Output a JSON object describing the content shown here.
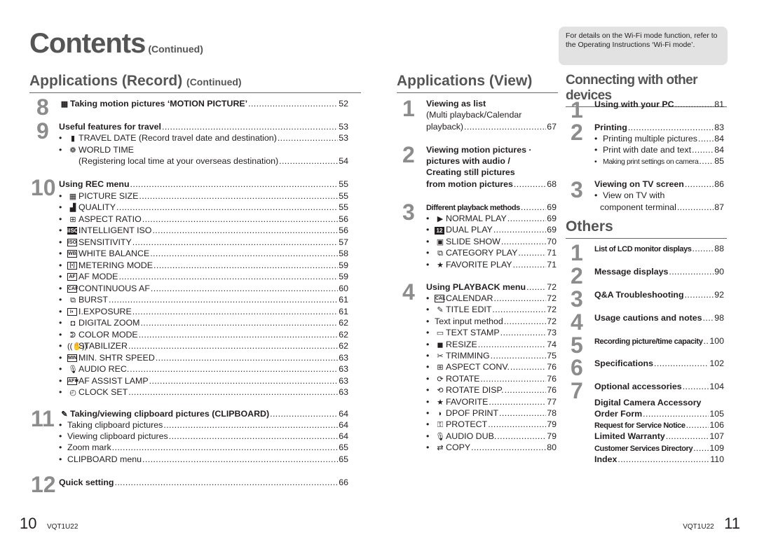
{
  "title": {
    "main": "Contents",
    "sub": "(Continued)"
  },
  "wifi_note": "For details on the Wi-Fi mode function, refer to the Operating Instructions ‘Wi-Fi mode’.",
  "record": {
    "heading": "Applications (Record)",
    "heading_sub": "(Continued)",
    "sections": [
      {
        "num": "8",
        "items": [
          {
            "icon": "motion-picture-icon",
            "glyph": "▦",
            "text": "Taking motion pictures ‘MOTION PICTURE’",
            "page": "52"
          }
        ]
      },
      {
        "num": "9",
        "items": [
          {
            "text": "Useful features for travel",
            "page": "53"
          },
          {
            "icon": "suitcase-icon",
            "glyph": "▮",
            "text": "TRAVEL DATE (Record travel date and destination)",
            "page": "53"
          },
          {
            "icon": "world-icon",
            "glyph": "❁",
            "text": "WORLD TIME",
            "page": ""
          },
          {
            "text": "(Registering local time at your overseas destination)",
            "page": "54"
          }
        ]
      },
      {
        "num": "10",
        "items": [
          {
            "text": "Using REC menu",
            "page": "55"
          },
          {
            "icon": "picture-size-icon",
            "glyph": "▦",
            "text": "PICTURE SIZE",
            "page": "55"
          },
          {
            "icon": "quality-icon",
            "glyph": "▟",
            "text": "QUALITY",
            "page": "55"
          },
          {
            "icon": "aspect-ratio-icon",
            "glyph": "⊞",
            "text": "ASPECT RATIO",
            "page": "56"
          },
          {
            "icon": "intelligent-iso-icon",
            "glyph": "iISO",
            "text": "INTELLIGENT ISO",
            "page": "56"
          },
          {
            "icon": "iso-icon",
            "glyph": "ISO",
            "text": "SENSITIVITY",
            "page": "57"
          },
          {
            "icon": "white-balance-icon",
            "glyph": "WB",
            "text": "WHITE BALANCE",
            "page": "58"
          },
          {
            "icon": "metering-icon",
            "glyph": "[•]",
            "text": "METERING MODE",
            "page": "59"
          },
          {
            "icon": "af-mode-icon",
            "glyph": "AF",
            "text": "AF MODE",
            "page": "59"
          },
          {
            "icon": "continuous-af-icon",
            "glyph": "CAF",
            "text": "CONTINUOUS AF",
            "page": "60"
          },
          {
            "icon": "burst-icon",
            "glyph": "⧉",
            "text": "BURST",
            "page": "61"
          },
          {
            "icon": "i-exposure-icon",
            "glyph": "i◐",
            "text": "I.EXPOSURE",
            "page": "61"
          },
          {
            "icon": "digital-zoom-icon",
            "glyph": "◘",
            "text": "DIGITAL ZOOM",
            "page": "62"
          },
          {
            "icon": "color-mode-icon",
            "glyph": "ᕲ",
            "text": "COLOR MODE",
            "page": "62"
          },
          {
            "icon": "stabilizer-icon",
            "glyph": "((✋))",
            "text": "STABILIZER",
            "page": "62"
          },
          {
            "icon": "min-shutter-icon",
            "glyph": "MIN",
            "text": "MIN. SHTR SPEED",
            "page": "63"
          },
          {
            "icon": "microphone-icon",
            "glyph": "🎙",
            "text": "AUDIO REC.",
            "page": "63"
          },
          {
            "icon": "af-assist-icon",
            "glyph": "AF✱",
            "text": "AF ASSIST LAMP",
            "page": "63"
          },
          {
            "icon": "clock-icon",
            "glyph": "◴",
            "text": "CLOCK SET",
            "page": "63"
          }
        ]
      },
      {
        "num": "11",
        "items": [
          {
            "icon": "clipboard-icon",
            "glyph": "✎",
            "text": "Taking/viewing clipboard pictures (CLIPBOARD)",
            "page": "64"
          },
          {
            "text": "Taking clipboard pictures",
            "page": "64"
          },
          {
            "text": "Viewing clipboard pictures",
            "page": "64"
          },
          {
            "text": "Zoom mark",
            "page": "65"
          },
          {
            "text": "CLIPBOARD menu",
            "page": "65"
          }
        ]
      },
      {
        "num": "12",
        "items": [
          {
            "text": "Quick setting",
            "page": "66"
          }
        ]
      }
    ]
  },
  "view": {
    "heading": "Applications (View)",
    "sections": [
      {
        "num": "1",
        "items": [
          {
            "text": "Viewing as list",
            "page": ""
          },
          {
            "text": "(Multi playback/Calendar",
            "page": ""
          },
          {
            "text": "playback)",
            "page": "67"
          }
        ]
      },
      {
        "num": "2",
        "items": [
          {
            "text": "Viewing motion pictures ·",
            "page": ""
          },
          {
            "text": "pictures with audio /",
            "page": ""
          },
          {
            "text": "Creating still pictures",
            "page": ""
          },
          {
            "text": "from motion pictures",
            "page": "68"
          }
        ]
      },
      {
        "num": "3",
        "items": [
          {
            "text": "Different playback methods",
            "page": "69"
          },
          {
            "icon": "play-icon",
            "glyph": "▶",
            "text": "NORMAL PLAY",
            "page": "69"
          },
          {
            "icon": "dual-play-icon",
            "glyph": "12",
            "text": "DUAL PLAY",
            "page": "69"
          },
          {
            "icon": "slide-show-icon",
            "glyph": "▣",
            "text": "SLIDE SHOW",
            "page": "70"
          },
          {
            "icon": "category-play-icon",
            "glyph": "⧉",
            "text": "CATEGORY PLAY",
            "page": "71"
          },
          {
            "icon": "star-icon",
            "glyph": "★",
            "text": "FAVORITE PLAY",
            "page": "71"
          }
        ]
      },
      {
        "num": "4",
        "items": [
          {
            "text": "Using PLAYBACK menu",
            "page": "72"
          },
          {
            "icon": "calendar-icon",
            "glyph": "CAL",
            "text": "CALENDAR",
            "page": "72"
          },
          {
            "icon": "title-edit-icon",
            "glyph": "✎",
            "text": "TITLE EDIT",
            "page": "72"
          },
          {
            "text": "Text input method",
            "page": "72"
          },
          {
            "icon": "text-stamp-icon",
            "glyph": "▭",
            "text": "TEXT STAMP",
            "page": "73"
          },
          {
            "icon": "resize-icon",
            "glyph": "◼",
            "text": "RESIZE",
            "page": "74"
          },
          {
            "icon": "scissors-icon",
            "glyph": "✂",
            "text": "TRIMMING",
            "page": "75"
          },
          {
            "icon": "aspect-conv-icon",
            "glyph": "⊞",
            "text": "ASPECT CONV.",
            "page": "76"
          },
          {
            "icon": "rotate-icon",
            "glyph": "⟳",
            "text": "ROTATE",
            "page": "76"
          },
          {
            "icon": "rotate-disp-icon",
            "glyph": "⟲",
            "text": "ROTATE DISP.",
            "page": "76"
          },
          {
            "icon": "star-icon",
            "glyph": "★",
            "text": "FAVORITE",
            "page": "77"
          },
          {
            "icon": "dpof-icon",
            "glyph": "◗",
            "text": "DPOF PRINT",
            "page": "78"
          },
          {
            "icon": "key-icon",
            "glyph": "⚿",
            "text": "PROTECT",
            "page": "79"
          },
          {
            "icon": "microphone-icon",
            "glyph": "🎙",
            "text": "AUDIO DUB.",
            "page": "79"
          },
          {
            "icon": "copy-icon",
            "glyph": "⇄",
            "text": "COPY",
            "page": "80"
          }
        ]
      }
    ]
  },
  "connect": {
    "heading": "Connecting with other devices",
    "sections": [
      {
        "num": "1",
        "items": [
          {
            "text": "Using with your PC",
            "page": "81"
          }
        ]
      },
      {
        "num": "2",
        "items": [
          {
            "text": "Printing",
            "page": "83"
          },
          {
            "text": "Printing multiple pictures",
            "page": "84"
          },
          {
            "text": "Print with date and text",
            "page": "84"
          },
          {
            "text": "Making print settings on camera",
            "page": "85"
          }
        ]
      },
      {
        "num": "3",
        "items": [
          {
            "text": "Viewing on TV screen",
            "page": "86"
          },
          {
            "text": "View on TV with",
            "page": ""
          },
          {
            "text": "component terminal",
            "page": "87"
          }
        ]
      }
    ]
  },
  "others": {
    "heading": "Others",
    "sections": [
      {
        "num": "1",
        "items": [
          {
            "text": "List of LCD monitor displays",
            "page": "88"
          }
        ]
      },
      {
        "num": "2",
        "items": [
          {
            "text": "Message displays",
            "page": "90"
          }
        ]
      },
      {
        "num": "3",
        "items": [
          {
            "text": "Q&A  Troubleshooting",
            "page": "92"
          }
        ]
      },
      {
        "num": "4",
        "items": [
          {
            "text": "Usage cautions and notes",
            "page": "98"
          }
        ]
      },
      {
        "num": "5",
        "items": [
          {
            "text": "Recording picture/time capacity",
            "page": "100"
          }
        ]
      },
      {
        "num": "6",
        "items": [
          {
            "text": "Specifications",
            "page": "102"
          }
        ]
      },
      {
        "num": "7",
        "items": [
          {
            "text": "Optional accessories",
            "page": "104"
          }
        ]
      }
    ],
    "extras": [
      {
        "text": "Digital Camera Accessory",
        "page": ""
      },
      {
        "text": "Order Form",
        "page": "105"
      },
      {
        "text": "Request for Service Notice",
        "page": "106"
      },
      {
        "text": "Limited Warranty",
        "page": "107"
      },
      {
        "text": "Customer Services Directory",
        "page": "109"
      },
      {
        "text": "Index",
        "page": "110"
      }
    ]
  },
  "footer": {
    "left_page": "10",
    "left_code": "VQT1U22",
    "right_code": "VQT1U22",
    "right_page": "11"
  }
}
